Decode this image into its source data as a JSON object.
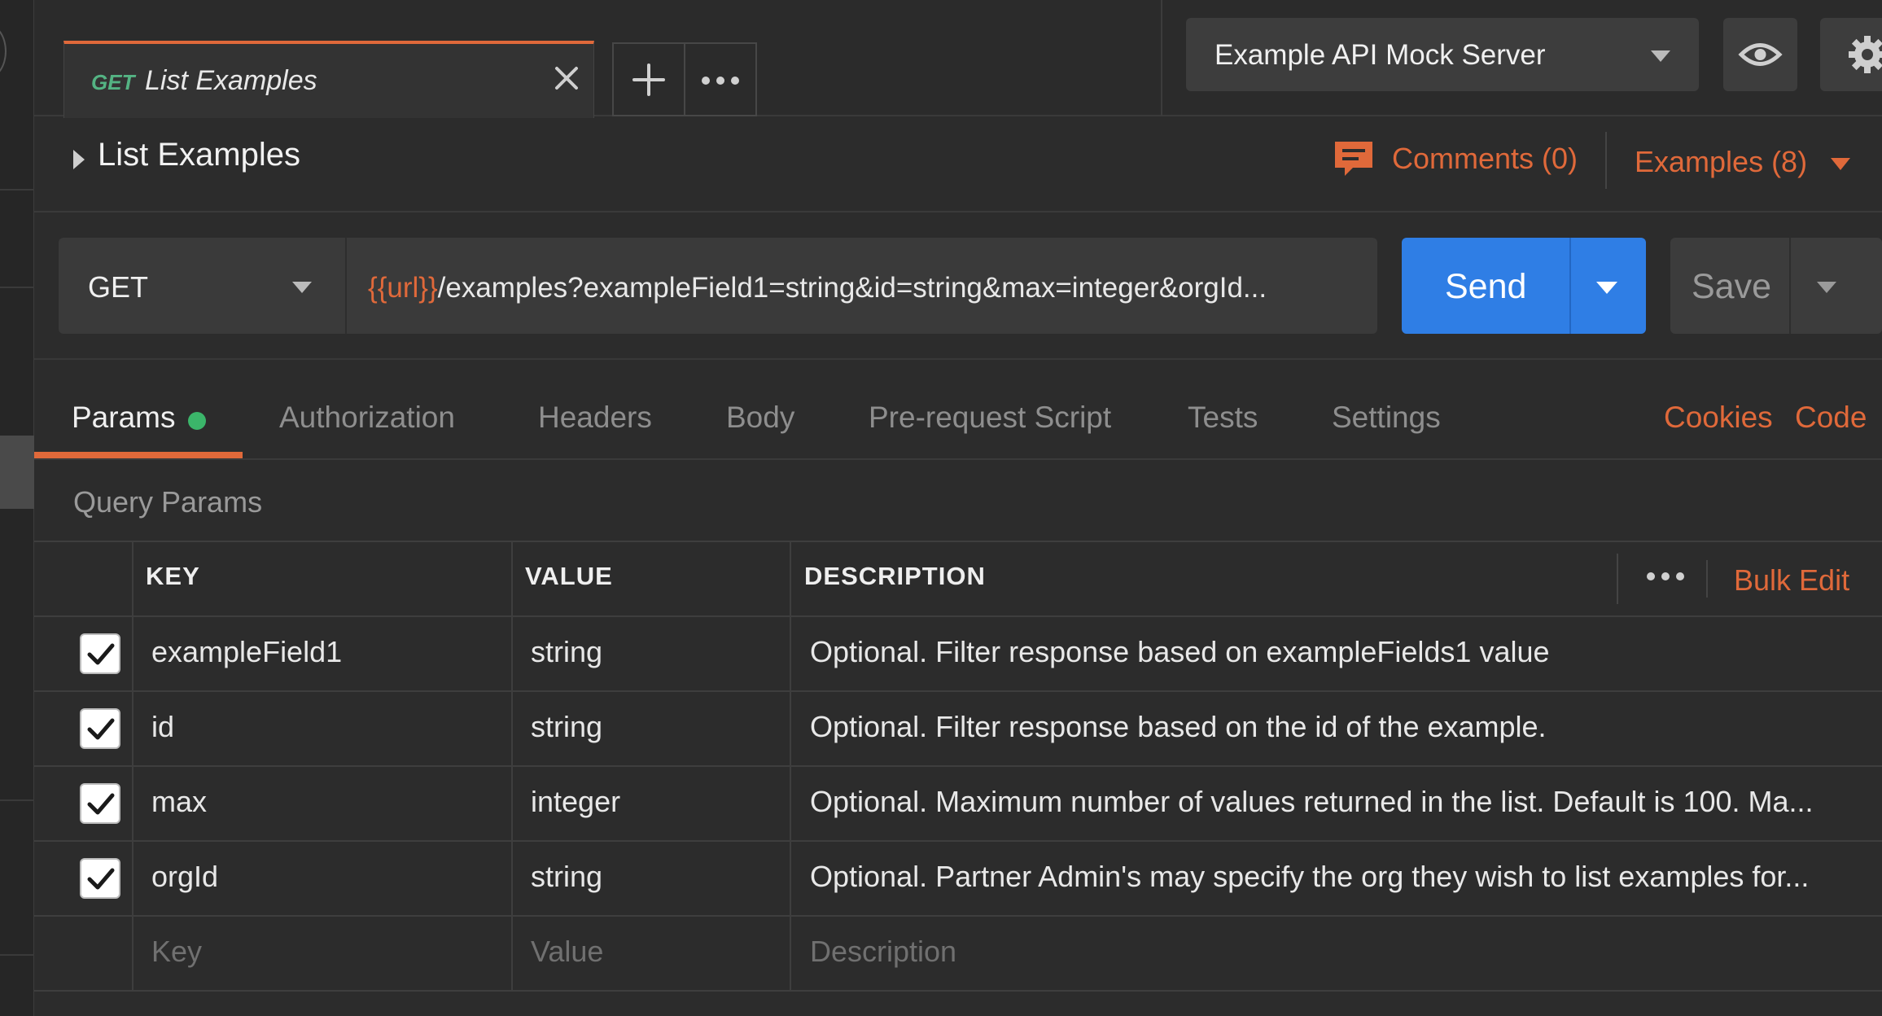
{
  "tabs": [
    {
      "method": "GET",
      "name": "List Examples"
    }
  ],
  "environment": {
    "selected": "Example API Mock Server"
  },
  "request": {
    "title": "List Examples",
    "comments_label": "Comments (0)",
    "examples_label": "Examples (8)",
    "method": "GET",
    "url_variable": "{{url}}",
    "url_path": "/examples?exampleField1=string&id=string&max=integer&orgId...",
    "send_label": "Send",
    "save_label": "Save"
  },
  "request_tabs": [
    "Params",
    "Authorization",
    "Headers",
    "Body",
    "Pre-request Script",
    "Tests",
    "Settings"
  ],
  "request_links": {
    "cookies": "Cookies",
    "code": "Code"
  },
  "query_params": {
    "section_label": "Query Params",
    "columns": {
      "key": "KEY",
      "value": "VALUE",
      "description": "DESCRIPTION"
    },
    "bulk_edit": "Bulk Edit",
    "rows": [
      {
        "checked": true,
        "key": "exampleField1",
        "value": "string",
        "description": "Optional. Filter response based on exampleFields1 value"
      },
      {
        "checked": true,
        "key": "id",
        "value": "string",
        "description": "Optional. Filter response based on the id of the example."
      },
      {
        "checked": true,
        "key": "max",
        "value": "integer",
        "description": "Optional. Maximum number of values returned in the list. Default is 100. Ma..."
      },
      {
        "checked": true,
        "key": "orgId",
        "value": "string",
        "description": "Optional.  Partner Admin's may specify the org they wish to list examples for..."
      }
    ],
    "placeholders": {
      "key": "Key",
      "value": "Value",
      "description": "Description"
    }
  },
  "colors": {
    "accent": "#e0693a",
    "send": "#2f7ee5",
    "get_method": "#54b383",
    "active_dot": "#3bb56a"
  },
  "icons": [
    "close-icon",
    "plus-icon",
    "more-icon",
    "chevron-down-icon",
    "eye-icon",
    "gear-icon",
    "comment-icon",
    "caret-right-icon",
    "checkbox-checked-icon"
  ]
}
